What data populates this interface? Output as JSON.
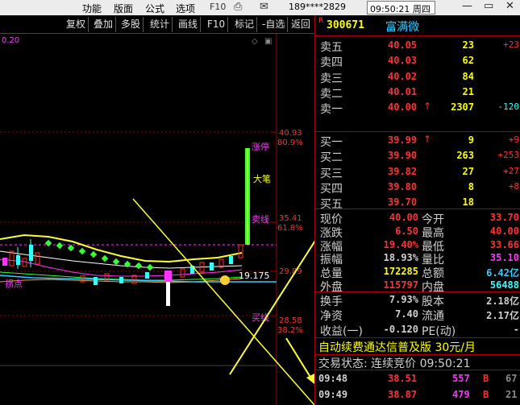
{
  "titlebar": {
    "menus": [
      "功能",
      "版面",
      "公式",
      "选项"
    ],
    "user": "189****2829",
    "clock": "09:50:21 周四",
    "f10_icon": "F10",
    "win_controls": [
      "—",
      "▭",
      "✕"
    ]
  },
  "toolbar": {
    "buttons": [
      "复权",
      "叠加",
      "多股",
      "统计",
      "画线",
      "F10",
      "标记",
      "-自选",
      "返回"
    ]
  },
  "chart": {
    "top_left_value": "0.20",
    "right_price_labels": [
      "40.93",
      "80.9%",
      "35.41",
      "61.8%",
      "29.89",
      "28.58",
      "38.2%"
    ],
    "annotations": {
      "limit_up": "涨停",
      "big_pen": "大笔",
      "sell_line": "卖线",
      "buy_line": "买线",
      "inflection": "拐点",
      "price_mark": "19.175"
    },
    "colors": {
      "bull": "#ff3030",
      "bear": "#33ffff",
      "buy_line": "#ffff33",
      "green_dots": "#33ff33",
      "magenta": "#ff33ff"
    }
  },
  "stock": {
    "r_mark": "R",
    "code": "300671",
    "name": "富满微"
  },
  "asks": [
    {
      "label": "卖五",
      "price": "40.05",
      "vol": "23",
      "chg": "+23",
      "chg_color": "#ff3030"
    },
    {
      "label": "卖四",
      "price": "40.03",
      "vol": "62",
      "chg": "",
      "chg_color": "#ff3030"
    },
    {
      "label": "卖三",
      "price": "40.02",
      "vol": "84",
      "chg": "",
      "chg_color": "#ff3030"
    },
    {
      "label": "卖二",
      "price": "40.01",
      "vol": "21",
      "chg": "",
      "chg_color": "#ff3030"
    },
    {
      "label": "卖一",
      "price": "40.00",
      "arrow": "↑",
      "vol": "2307",
      "chg": "-120",
      "chg_color": "#33ffff"
    }
  ],
  "bids": [
    {
      "label": "买一",
      "price": "39.99",
      "arrow": "↑",
      "vol": "9",
      "chg": "+9",
      "chg_color": "#ff3030"
    },
    {
      "label": "买二",
      "price": "39.90",
      "vol": "263",
      "chg": "+253",
      "chg_color": "#ff3030"
    },
    {
      "label": "买三",
      "price": "39.82",
      "vol": "27",
      "chg": "+27",
      "chg_color": "#ff3030"
    },
    {
      "label": "买四",
      "price": "39.80",
      "vol": "8",
      "chg": "+8",
      "chg_color": "#ff3030"
    },
    {
      "label": "买五",
      "price": "39.70",
      "vol": "18",
      "chg": "",
      "chg_color": "#ff3030"
    }
  ],
  "quotes": [
    {
      "l1": "现价",
      "v1": "40.00",
      "c1": "#ff3030",
      "l2": "今开",
      "v2": "33.70",
      "c2": "#ff3030"
    },
    {
      "l1": "涨跌",
      "v1": "6.50",
      "c1": "#ff3030",
      "l2": "最高",
      "v2": "40.00",
      "c2": "#ff3030"
    },
    {
      "l1": "涨幅",
      "v1": "19.40%",
      "c1": "#ff3030",
      "l2": "最低",
      "v2": "33.66",
      "c2": "#ff3030"
    },
    {
      "l1": "振幅",
      "v1": "18.93%",
      "c1": "#d0d0d0",
      "l2": "量比",
      "v2": "35.10",
      "c2": "#ff33ff"
    },
    {
      "l1": "总量",
      "v1": "172285",
      "c1": "#ffff00",
      "l2": "总额",
      "v2": "6.42亿",
      "c2": "#33ccff"
    },
    {
      "l1": "外盘",
      "v1": "115797",
      "c1": "#ff3030",
      "l2": "内盘",
      "v2": "56488",
      "c2": "#33ffff"
    }
  ],
  "fundamentals": [
    {
      "l1": "换手",
      "v1": "7.93%",
      "c1": "#d0d0d0",
      "l2": "股本",
      "v2": "2.18亿",
      "c2": "#d0d0d0"
    },
    {
      "l1": "净资",
      "v1": "7.40",
      "c1": "#d0d0d0",
      "l2": "流通",
      "v2": "2.17亿",
      "c2": "#d0d0d0"
    },
    {
      "l1": "收益(一)",
      "v1": "-0.120",
      "c1": "#d0d0d0",
      "l2": "PE(动)",
      "v2": "-",
      "c2": "#d0d0d0"
    }
  ],
  "auto_renew": "自动续费通达信普及版  30元/月",
  "trade_status": "交易状态: 连续竞价  09:50:21",
  "ticks": [
    {
      "time": "09:48",
      "price": "38.51",
      "vol": "557",
      "side": "B",
      "extra": "67"
    },
    {
      "time": "09:49",
      "price": "38.87",
      "vol": "479",
      "side": "B",
      "extra": "21"
    }
  ]
}
